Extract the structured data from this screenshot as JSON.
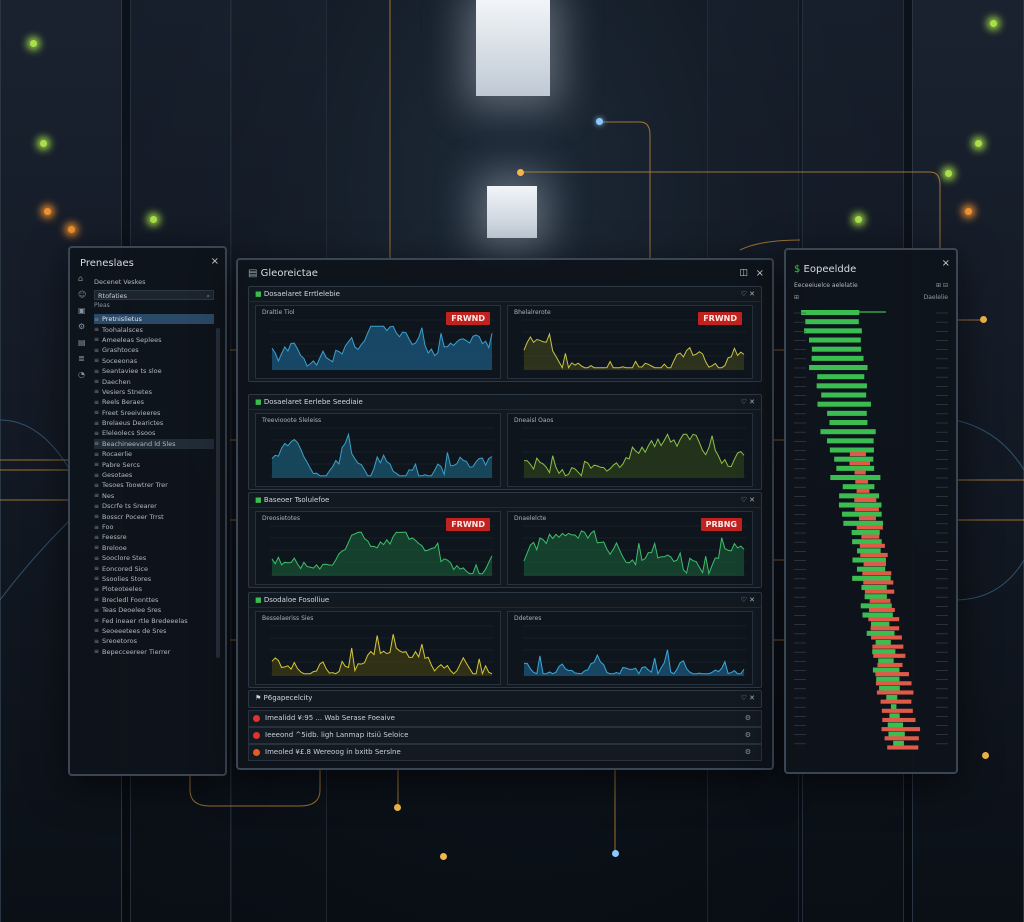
{
  "left_panel": {
    "title": "Preneslaes",
    "subtitle": "Decenet Veskes",
    "search_value": "Rtofaties",
    "section_label": "Pleas",
    "close_icon": "×",
    "items": [
      {
        "icon": "≡",
        "label": "Pretnislietus"
      },
      {
        "icon": "≡",
        "label": "Toohalalsces"
      },
      {
        "icon": "≡",
        "label": "Ameeleas Seplees"
      },
      {
        "icon": "≡",
        "label": "Grashtoces"
      },
      {
        "icon": "≡",
        "label": "Soceeonas"
      },
      {
        "icon": "≡",
        "label": "Seantaviee ts sloe"
      },
      {
        "icon": "≡",
        "label": "Daechen"
      },
      {
        "icon": "≡",
        "label": "Vesiers Stnetes"
      },
      {
        "icon": "≡",
        "label": "Reels Beraes"
      },
      {
        "icon": "≡",
        "label": "Freet Sreeivieeres"
      },
      {
        "icon": "≡",
        "label": "Brelaeus Dearictes"
      },
      {
        "icon": "≡",
        "label": "Eleleolecs Ssoos"
      },
      {
        "icon": "≡",
        "label": "Beachineevand ld Sles"
      },
      {
        "icon": "≡",
        "label": "Rocaerlie"
      },
      {
        "icon": "≡",
        "label": "Pabre Sercs"
      },
      {
        "icon": "≡",
        "label": "Gesotaes"
      },
      {
        "icon": "≡",
        "label": "Tesoes Toowtrer Trer"
      },
      {
        "icon": "≡",
        "label": "Nes"
      },
      {
        "icon": "≡",
        "label": "Dscrfe ts Srearer"
      },
      {
        "icon": "≡",
        "label": "Bosscr Poceer Trrst"
      },
      {
        "icon": "≡",
        "label": "Foo"
      },
      {
        "icon": "≡",
        "label": "Feessre"
      },
      {
        "icon": "≡",
        "label": "Brelooe"
      },
      {
        "icon": "≡",
        "label": "Sooclore Stes"
      },
      {
        "icon": "≡",
        "label": "Eoncored Sice"
      },
      {
        "icon": "≡",
        "label": "Ssoolies Stores"
      },
      {
        "icon": "≡",
        "label": "Ploteoteeles"
      },
      {
        "icon": "≡",
        "label": "Brecledl Foonttes"
      },
      {
        "icon": "≡",
        "label": "Teas Deoelee Sres"
      },
      {
        "icon": "≡",
        "label": "Fed ineaer rtle Bredeeelas"
      },
      {
        "icon": "≡",
        "label": "Seoeeetees de Sres"
      },
      {
        "icon": "≡",
        "label": "Sreoetoros"
      },
      {
        "icon": "≡",
        "label": "Bepecceereer Tierrer"
      }
    ]
  },
  "main_panel": {
    "title": "Gleoreictae",
    "window_buttons": [
      "◫",
      "×"
    ],
    "rows": [
      {
        "title": "Dosaelaret Errtlelebie",
        "charts": [
          {
            "title": "Draltie Tiol",
            "badge": "FRWND",
            "color": "#3aa0d0",
            "fill": "#1b5d83"
          },
          {
            "title": "Bhelalrerote",
            "badge": "FRWND",
            "color": "#c8c24a",
            "fill": "#3b3f1e"
          }
        ]
      },
      {
        "title": "Dosaelaret Eerlebe Seediaie",
        "charts": [
          {
            "title": "Treeviooote Sleleiss",
            "badge": "",
            "color": "#3aa0c8",
            "fill": "#1b5a75"
          },
          {
            "title": "Dneaisl Oaos",
            "badge": "",
            "color": "#8ec04a",
            "fill": "#2b3e1b"
          }
        ]
      },
      {
        "title": "Baseoer Tsolulefoe",
        "charts": [
          {
            "title": "Dreosietotes",
            "badge": "FRWND",
            "color": "#3cbf6a",
            "fill": "#185334"
          },
          {
            "title": "Dnaelelcte",
            "badge": "PRBNG",
            "color": "#3cbf6a",
            "fill": "#185334"
          }
        ]
      },
      {
        "title": "Dsodaloe Fosolliue",
        "charts": [
          {
            "title": "Besselaeriss Sies",
            "badge": "",
            "color": "#d4c63a",
            "fill": "#3e3c14"
          },
          {
            "title": "Ddeteres",
            "badge": "",
            "color": "#3aa8d8",
            "fill": "#1b5a80"
          }
        ]
      }
    ],
    "alerts_title": "P6gapecelcity",
    "alerts": [
      {
        "text": "Imealidd ¥:95 ... Wab Serase Foeaive",
        "color": "#d33"
      },
      {
        "text": "Ieeeond ^5idb. ligh Lanmap itsiü Seloice",
        "color": "#d33"
      },
      {
        "text": "Imeoled ¥£.8 Wereoog in bxitb Serslne",
        "color": "#e65a24"
      }
    ],
    "row_controls": "♡ ✕"
  },
  "right_panel": {
    "title": "Eopeeldde",
    "subtitle": "Eeceeiuelce aelelatie",
    "controls": "⊞ ⊟",
    "top_labels": [
      "⊞",
      "Daelelie"
    ]
  },
  "colors": {
    "green": "#3bbd52",
    "red": "#e05a48",
    "accent_blue": "#3aa0d0",
    "node_yellow": "#f2b84b"
  }
}
